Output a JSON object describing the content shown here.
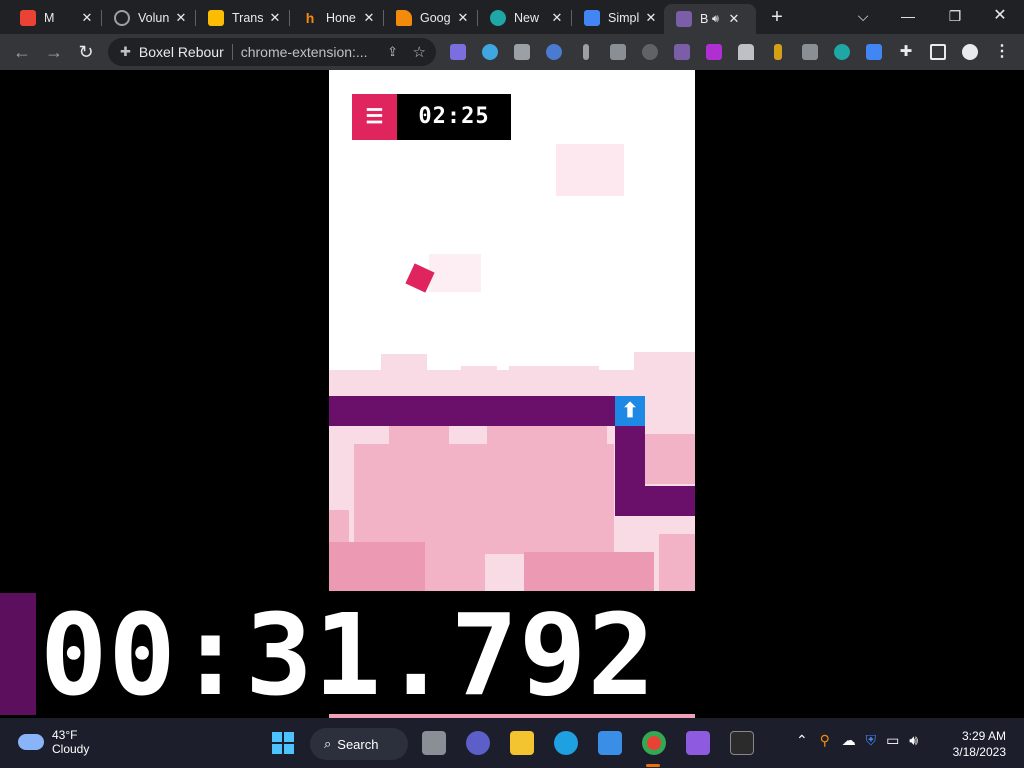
{
  "browser": {
    "tabs": [
      {
        "title": "M",
        "color": "#ea4335"
      },
      {
        "title": "Volun",
        "color": "#9aa0a6"
      },
      {
        "title": "Trans",
        "color": "#fbbc04"
      },
      {
        "title": "Hone",
        "color": "#f28b0c"
      },
      {
        "title": "Goog",
        "color": "#f28b0c"
      },
      {
        "title": "New",
        "color": "#1ea7a4"
      },
      {
        "title": "Simpl",
        "color": "#4285f4"
      },
      {
        "title": "B",
        "color": "#7b5ea7"
      }
    ],
    "omnibox": {
      "extension_name": "Boxel Rebour",
      "url": "chrome-extension:..."
    }
  },
  "game": {
    "timer": "02:25",
    "menu_icon": "hamburger-icon",
    "big_timer": "00:31.792",
    "colors": {
      "player": "#e0245e",
      "platform": "#6a0f6a",
      "jump_pad": "#1e88e5",
      "background_blocks": "#f4b6c8"
    }
  },
  "taskbar": {
    "weather_temp": "43°F",
    "weather_desc": "Cloudy",
    "search_label": "Search",
    "time": "3:29 AM",
    "date": "3/18/2023"
  }
}
